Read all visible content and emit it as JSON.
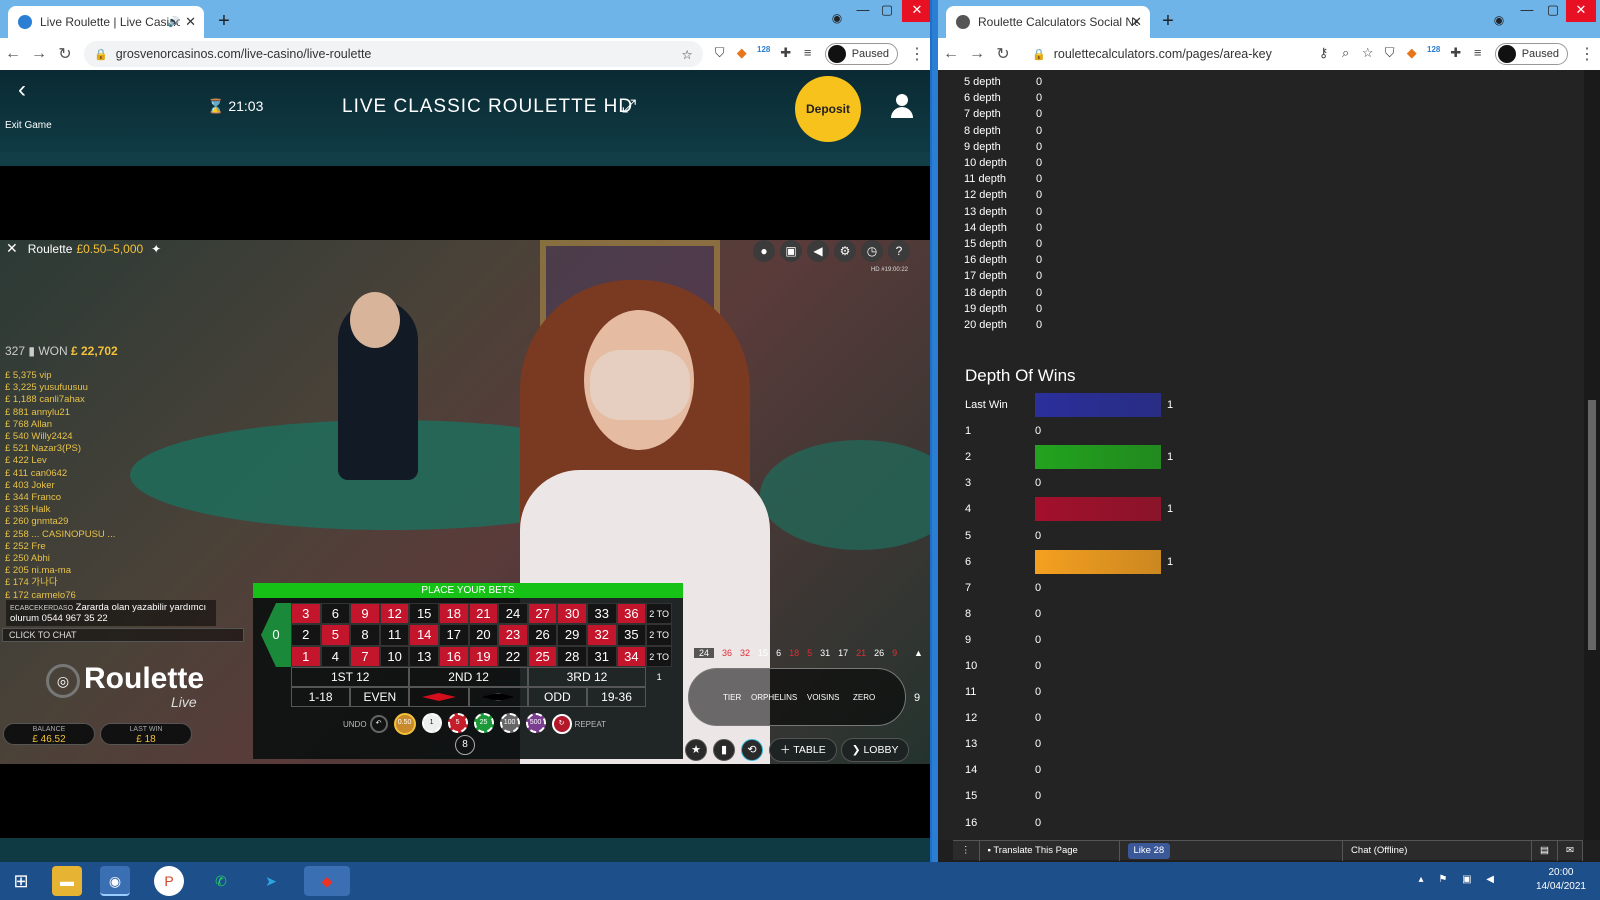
{
  "left_window": {
    "tab_title": "Live Roulette | Live Casino | G",
    "url": "grosvenorcasinos.com/live-casino/live-roulette",
    "paused": "Paused",
    "ext_badge": "128"
  },
  "casino": {
    "exit_label": "Exit Game",
    "timer": "21:03",
    "title": "LIVE CLASSIC ROULETTE HD",
    "deposit": "Deposit"
  },
  "game": {
    "table_name": "Roulette",
    "limits": "£0.50–5,000",
    "hd_tag": "HD #19:00:22",
    "players": "327",
    "won_label": "WON",
    "won_amount": "£ 22,702",
    "winners": [
      "£ 5,375 vip",
      "£ 3,225 yusufuusuu",
      "£ 1,188 canli7ahax",
      "£ 881 annylu21",
      "£ 768 Allan",
      "£ 540 Willy2424",
      "£ 521 Nazar3(PS)",
      "£ 422 Lev",
      "£ 411 can0642",
      "£ 403 Joker",
      "£ 344 Franco",
      "£ 335 Halk",
      "£ 260 gnmta29",
      "£ 258 ... CASINOPUSU ...",
      "£ 252 Fre",
      "£ 250 Abhi",
      "£ 205 ni.ma-ma",
      "£ 174 가나다",
      "£ 172 carmelo76"
    ],
    "chat_name": "ECABCEKERDASO",
    "chat_text": "Zararda olan yazabilir yardımcı olurum 0544 967 35 22",
    "click_to_chat": "CLICK TO CHAT",
    "logo_text": "Roulette",
    "logo_sub": "Live",
    "balance_label": "BALANCE",
    "balance": "£ 46.52",
    "lastwin_label": "LAST WIN",
    "lastwin": "£ 18",
    "place_bets": "PLACE YOUR BETS",
    "zero": "0",
    "rows": [
      [
        "3",
        "6",
        "9",
        "12",
        "15",
        "18",
        "21",
        "24",
        "27",
        "30",
        "33",
        "36"
      ],
      [
        "2",
        "5",
        "8",
        "11",
        "14",
        "17",
        "20",
        "23",
        "26",
        "29",
        "32",
        "35"
      ],
      [
        "1",
        "4",
        "7",
        "10",
        "13",
        "16",
        "19",
        "22",
        "25",
        "28",
        "31",
        "34"
      ]
    ],
    "reds": [
      "1",
      "3",
      "5",
      "7",
      "9",
      "12",
      "14",
      "16",
      "18",
      "19",
      "21",
      "23",
      "25",
      "27",
      "30",
      "32",
      "34",
      "36"
    ],
    "column_bet": "2 TO 1",
    "dozens": [
      "1ST 12",
      "2ND 12",
      "3RD 12"
    ],
    "outside": [
      "1-18",
      "EVEN",
      "",
      "",
      "ODD",
      "19-36"
    ],
    "undo": "UNDO",
    "repeat": "REPEAT",
    "chip_count": "8",
    "chips": [
      "0.50",
      "1",
      "5",
      "25",
      "100",
      "500"
    ],
    "recent": [
      "24",
      "36",
      "32",
      "15",
      "6",
      "18",
      "5",
      "31",
      "17",
      "21",
      "26",
      "9"
    ],
    "race_labels": [
      "TIER",
      "ORPHELINS",
      "VOISINS",
      "ZERO"
    ],
    "race_side": "9",
    "table_btn": "TABLE",
    "lobby_btn": "LOBBY"
  },
  "right_window": {
    "tab_title": "Roulette Calculators Social Netw",
    "url": "roulettecalculators.com/pages/area-key",
    "paused": "Paused",
    "ext_badge": "128",
    "depths": [
      {
        "label": "5 depth",
        "value": "0"
      },
      {
        "label": "6 depth",
        "value": "0"
      },
      {
        "label": "7 depth",
        "value": "0"
      },
      {
        "label": "8 depth",
        "value": "0"
      },
      {
        "label": "9 depth",
        "value": "0"
      },
      {
        "label": "10 depth",
        "value": "0"
      },
      {
        "label": "11 depth",
        "value": "0"
      },
      {
        "label": "12 depth",
        "value": "0"
      },
      {
        "label": "13 depth",
        "value": "0"
      },
      {
        "label": "14 depth",
        "value": "0"
      },
      {
        "label": "15 depth",
        "value": "0"
      },
      {
        "label": "16 depth",
        "value": "0"
      },
      {
        "label": "17 depth",
        "value": "0"
      },
      {
        "label": "18 depth",
        "value": "0"
      },
      {
        "label": "19 depth",
        "value": "0"
      },
      {
        "label": "20 depth",
        "value": "0"
      }
    ],
    "depth_of_wins_title": "Depth Of Wins",
    "wins": [
      {
        "label": "Last Win",
        "value": "1",
        "color": "#2a2f9b"
      },
      {
        "label": "1",
        "value": "0"
      },
      {
        "label": "2",
        "value": "1",
        "color": "#22a31e"
      },
      {
        "label": "3",
        "value": "0"
      },
      {
        "label": "4",
        "value": "1",
        "color": "#a3102c"
      },
      {
        "label": "5",
        "value": "0"
      },
      {
        "label": "6",
        "value": "1",
        "color": "#f5a020"
      },
      {
        "label": "7",
        "value": "0"
      },
      {
        "label": "8",
        "value": "0"
      },
      {
        "label": "9",
        "value": "0"
      },
      {
        "label": "10",
        "value": "0"
      },
      {
        "label": "11",
        "value": "0"
      },
      {
        "label": "12",
        "value": "0"
      },
      {
        "label": "13",
        "value": "0"
      },
      {
        "label": "14",
        "value": "0"
      },
      {
        "label": "15",
        "value": "0"
      },
      {
        "label": "16",
        "value": "0"
      }
    ],
    "translate": "Translate This Page",
    "like": "Like 28",
    "chat": "Chat (Offline)"
  },
  "taskbar": {
    "time": "20:00",
    "date": "14/04/2021"
  }
}
